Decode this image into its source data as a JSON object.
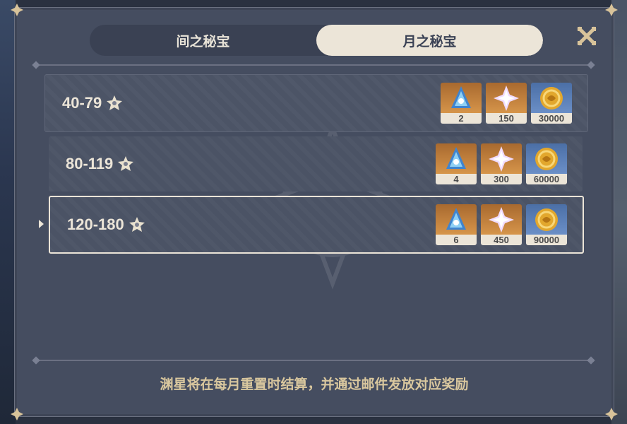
{
  "tabs": [
    {
      "label": "间之秘宝",
      "active": false
    },
    {
      "label": "月之秘宝",
      "active": true
    }
  ],
  "tiers": [
    {
      "range": "40-79",
      "rewards": [
        {
          "icon": "intertwined-fate-icon",
          "count": "2"
        },
        {
          "icon": "primogem-icon",
          "count": "150"
        },
        {
          "icon": "mora-icon",
          "count": "30000"
        }
      ]
    },
    {
      "range": "80-119",
      "rewards": [
        {
          "icon": "intertwined-fate-icon",
          "count": "4"
        },
        {
          "icon": "primogem-icon",
          "count": "300"
        },
        {
          "icon": "mora-icon",
          "count": "60000"
        }
      ]
    },
    {
      "range": "120-180",
      "rewards": [
        {
          "icon": "intertwined-fate-icon",
          "count": "6"
        },
        {
          "icon": "primogem-icon",
          "count": "450"
        },
        {
          "icon": "mora-icon",
          "count": "90000"
        }
      ]
    }
  ],
  "footer": "渊星将在每月重置时结算，并通过邮件发放对应奖励",
  "colors": {
    "panel": "#454d60",
    "accent_cream": "#ece5d8",
    "footer_gold": "#d9c79e",
    "reward_gold_bg": "#c98a42",
    "reward_blue_bg": "#5a7fb8"
  }
}
